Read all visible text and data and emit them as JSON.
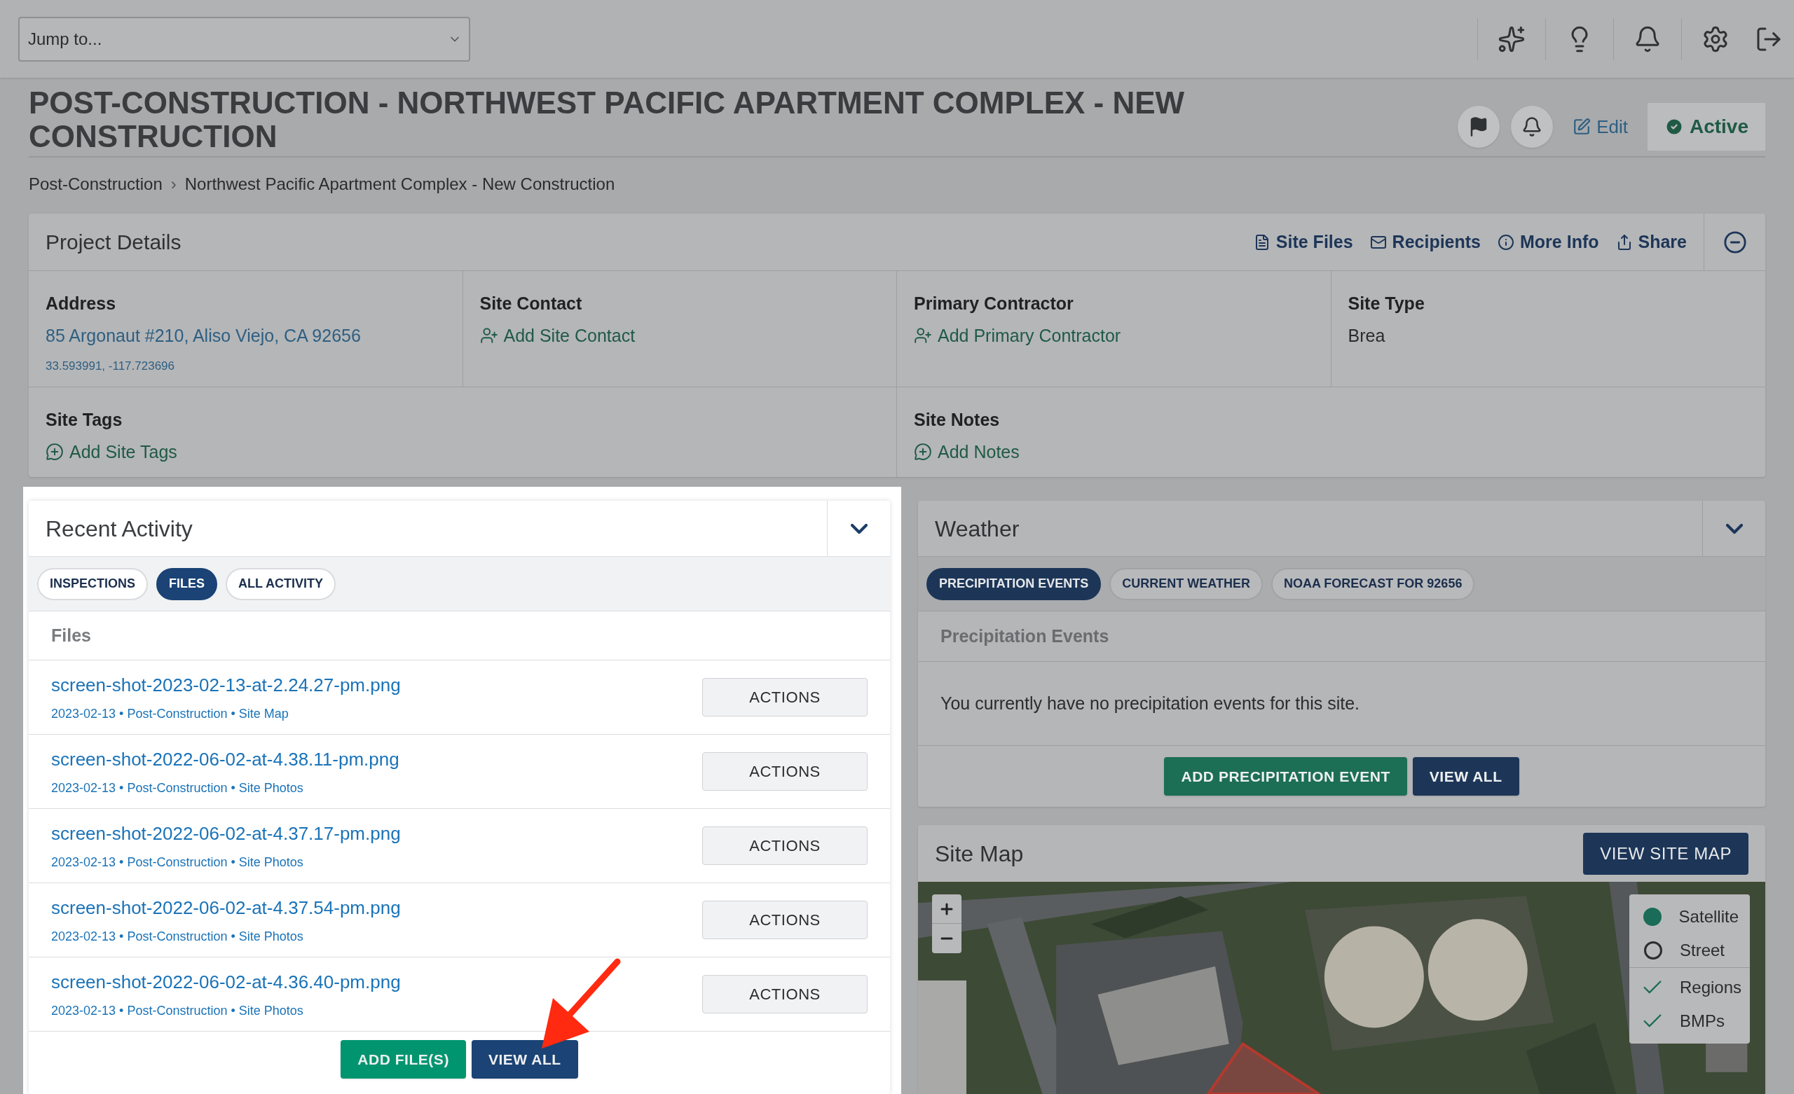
{
  "top_bar": {
    "jump_to": {
      "placeholder": "Jump to..."
    }
  },
  "page": {
    "title": "POST-CONSTRUCTION - NORTHWEST PACIFIC APARTMENT COMPLEX - NEW CONSTRUCTION",
    "breadcrumb": [
      "Post-Construction",
      "Northwest Pacific Apartment Complex - New Construction"
    ],
    "breadcrumb_separator": "›",
    "edit": "Edit",
    "status": "Active"
  },
  "project_details": {
    "title": "Project Details",
    "links": [
      {
        "label": "Site Files",
        "kind": "file"
      },
      {
        "label": "Recipients",
        "kind": "mail"
      },
      {
        "label": "More Info",
        "kind": "info"
      },
      {
        "label": "Share",
        "kind": "share"
      }
    ],
    "fields": [
      {
        "label": "Address",
        "kind": "address",
        "value": "85 Argonaut #210, Aliso Viejo, CA 92656",
        "coords": "33.593991, -117.723696"
      },
      {
        "label": "Site Contact",
        "kind": "add_person",
        "value": "Add Site Contact"
      },
      {
        "label": "Primary Contractor",
        "kind": "add_person",
        "value": "Add Primary Contractor"
      },
      {
        "label": "Site Type",
        "kind": "plain",
        "value": "Brea"
      },
      {
        "label": "Site Tags",
        "kind": "add_comment",
        "value": "Add Site Tags"
      },
      {
        "label": "Site Notes",
        "kind": "add_comment",
        "value": "Add Notes"
      }
    ]
  },
  "recent_activity": {
    "title": "Recent Activity",
    "tabs": [
      {
        "label": "INSPECTIONS",
        "selected": false
      },
      {
        "label": "FILES",
        "selected": true
      },
      {
        "label": "ALL ACTIVITY",
        "selected": false
      }
    ],
    "section_title": "Files",
    "files": [
      {
        "name": "screen-shot-2023-02-13-at-2.24.27-pm.png",
        "meta": "2023-02-13 • Post-Construction • Site Map",
        "action": "ACTIONS"
      },
      {
        "name": "screen-shot-2022-06-02-at-4.38.11-pm.png",
        "meta": "2023-02-13 • Post-Construction • Site Photos",
        "action": "ACTIONS"
      },
      {
        "name": "screen-shot-2022-06-02-at-4.37.17-pm.png",
        "meta": "2023-02-13 • Post-Construction • Site Photos",
        "action": "ACTIONS"
      },
      {
        "name": "screen-shot-2022-06-02-at-4.37.54-pm.png",
        "meta": "2023-02-13 • Post-Construction • Site Photos",
        "action": "ACTIONS"
      },
      {
        "name": "screen-shot-2022-06-02-at-4.36.40-pm.png",
        "meta": "2023-02-13 • Post-Construction • Site Photos",
        "action": "ACTIONS"
      }
    ],
    "buttons": [
      {
        "label": "ADD FILE(S)",
        "kind": "primary"
      },
      {
        "label": "VIEW ALL",
        "kind": "secondary"
      }
    ]
  },
  "weather": {
    "title": "Weather",
    "tabs": [
      {
        "label": "PRECIPITATION EVENTS",
        "selected": true
      },
      {
        "label": "CURRENT WEATHER",
        "selected": false
      },
      {
        "label": "NOAA FORECAST FOR 92656",
        "selected": false
      }
    ],
    "section_title": "Precipitation Events",
    "message": "You currently have no precipitation events for this site.",
    "buttons": [
      {
        "label": "ADD PRECIPITATION EVENT",
        "kind": "primary"
      },
      {
        "label": "VIEW ALL",
        "kind": "secondary"
      }
    ]
  },
  "site_map": {
    "title": "Site Map",
    "button": "VIEW SITE MAP",
    "layers": [
      {
        "label": "Satellite",
        "kind": "radio",
        "selected": true
      },
      {
        "label": "Street",
        "kind": "radio",
        "selected": false
      },
      {
        "label": "Regions",
        "kind": "check",
        "checked": true
      },
      {
        "label": "BMPs",
        "kind": "check",
        "checked": true
      }
    ]
  }
}
